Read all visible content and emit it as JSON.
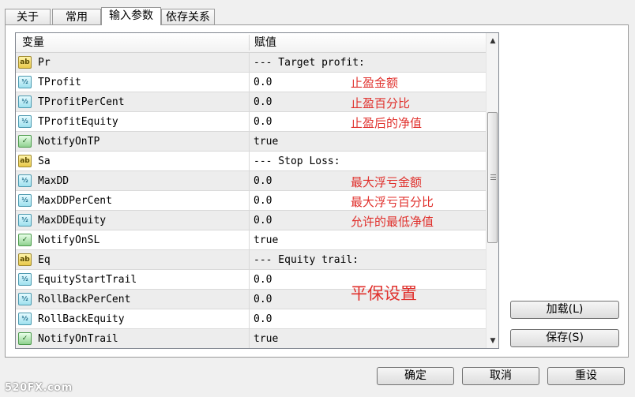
{
  "tabs": [
    "关于",
    "常用",
    "输入参数",
    "依存关系"
  ],
  "active_tab": "输入参数",
  "grid": {
    "col_name": "变量",
    "col_value": "赋值",
    "rows": [
      {
        "type": "ab",
        "icon": "string-param-icon",
        "name": "Pr",
        "value": "--- Target profit:"
      },
      {
        "type": "num",
        "icon": "number-param-icon",
        "name": "TProfit",
        "value": "0.0"
      },
      {
        "type": "num",
        "icon": "number-param-icon",
        "name": "TProfitPerCent",
        "value": "0.0"
      },
      {
        "type": "num",
        "icon": "number-param-icon",
        "name": "TProfitEquity",
        "value": "0.0"
      },
      {
        "type": "bool",
        "icon": "bool-param-icon",
        "name": "NotifyOnTP",
        "value": "true"
      },
      {
        "type": "ab",
        "icon": "string-param-icon",
        "name": "Sa",
        "value": "--- Stop Loss:"
      },
      {
        "type": "num",
        "icon": "number-param-icon",
        "name": "MaxDD",
        "value": "0.0"
      },
      {
        "type": "num",
        "icon": "number-param-icon",
        "name": "MaxDDPerCent",
        "value": "0.0"
      },
      {
        "type": "num",
        "icon": "number-param-icon",
        "name": "MaxDDEquity",
        "value": "0.0"
      },
      {
        "type": "bool",
        "icon": "bool-param-icon",
        "name": "NotifyOnSL",
        "value": "true"
      },
      {
        "type": "ab",
        "icon": "string-param-icon",
        "name": "Eq",
        "value": "--- Equity trail:"
      },
      {
        "type": "num",
        "icon": "number-param-icon",
        "name": "EquityStartTrail",
        "value": "0.0"
      },
      {
        "type": "num",
        "icon": "number-param-icon",
        "name": "RollBackPerCent",
        "value": "0.0"
      },
      {
        "type": "num",
        "icon": "number-param-icon",
        "name": "RollBackEquity",
        "value": "0.0"
      },
      {
        "type": "bool",
        "icon": "bool-param-icon",
        "name": "NotifyOnTrail",
        "value": "true"
      }
    ]
  },
  "annotations": [
    "止盈金额",
    "止盈百分比",
    "止盈后的净值",
    "最大浮亏金额",
    "最大浮亏百分比",
    "允许的最低净值",
    "平保设置"
  ],
  "buttons": {
    "load": "加载(L)",
    "save": "保存(S)",
    "ok": "确定",
    "cancel": "取消",
    "reset": "重设"
  },
  "watermark": "520FX.com",
  "colors": {
    "annotation": "#e0302c"
  }
}
